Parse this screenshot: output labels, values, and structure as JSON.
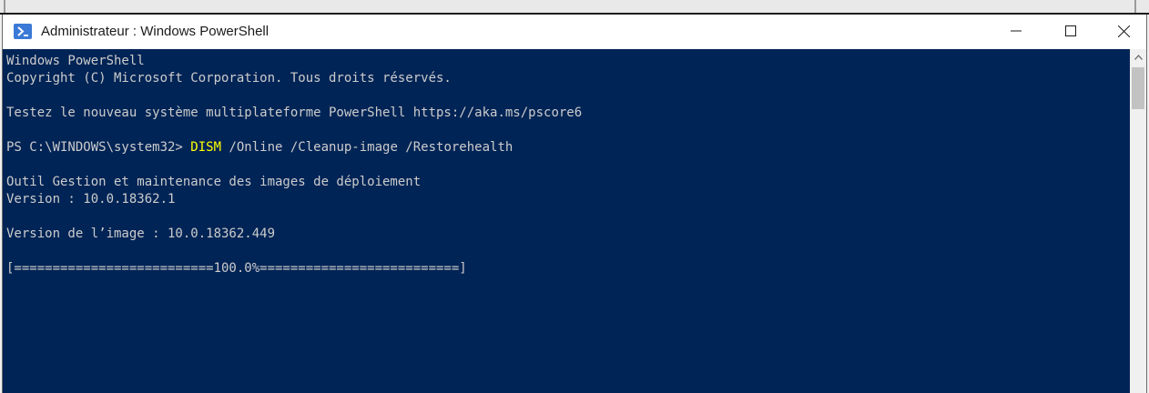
{
  "window": {
    "title": "Administrateur : Windows PowerShell",
    "icons": {
      "app": "powershell-icon",
      "minimize": "minimize-icon",
      "maximize": "maximize-icon",
      "close": "close-icon",
      "scroll_up": "chevron-up-icon"
    }
  },
  "console": {
    "lines": {
      "l1": "Windows PowerShell",
      "l2": "Copyright (C) Microsoft Corporation. Tous droits réservés.",
      "l3": "Testez le nouveau système multiplateforme PowerShell https://aka.ms/pscore6",
      "prompt": "PS C:\\WINDOWS\\system32> ",
      "command": "DISM",
      "args": " /Online /Cleanup-image /Restorehealth",
      "l5": "Outil Gestion et maintenance des images de déploiement",
      "l6": "Version : 10.0.18362.1",
      "l7": "Version de l’image : 10.0.18362.449",
      "progress": "[==========================100.0%==========================]"
    }
  },
  "colors": {
    "console_bg": "#012456",
    "console_text": "#cccccc",
    "command_highlight": "#ffff00"
  }
}
